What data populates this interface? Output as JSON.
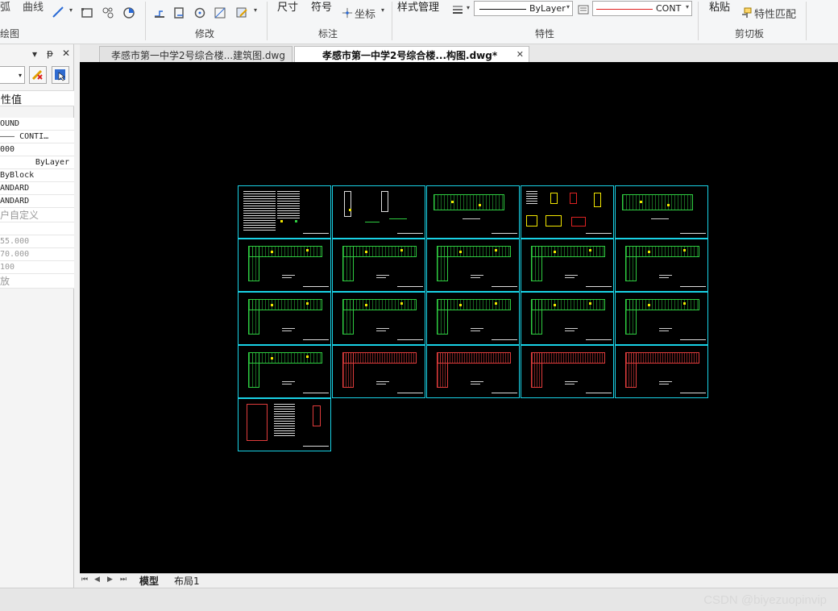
{
  "ribbon": {
    "draw_items": {
      "arc": "弧",
      "curve": "曲线"
    },
    "groups": {
      "draw": "绘图",
      "modify": "修改",
      "annotate": "标注",
      "properties": "特性",
      "clipboard": "剪切板"
    },
    "annotate_items": {
      "dimension": "尺寸",
      "symbol": "符号",
      "coordinate": "坐标"
    },
    "style_manager": "样式管理",
    "layer_dropdown": {
      "value": "ByLayer"
    },
    "linetype_dropdown": {
      "value": "CONT"
    },
    "clipboard_items": {
      "paste": "粘贴",
      "match_properties": "特性匹配"
    }
  },
  "palette": {
    "title_buttons": [
      "▾",
      "ᵽ",
      "✕"
    ],
    "header": "性值",
    "rows": [
      {
        "text": "OUND",
        "style": "normal"
      },
      {
        "text": "——— CONTI…",
        "style": "normal"
      },
      {
        "text": "000",
        "style": "normal"
      },
      {
        "text": "ByLayer",
        "style": "right"
      },
      {
        "text": "ByBlock",
        "style": "normal"
      },
      {
        "text": "ANDARD",
        "style": "normal"
      },
      {
        "text": "ANDARD",
        "style": "normal"
      },
      {
        "text": "户自定义",
        "style": "cat"
      },
      {
        "text": "",
        "style": "normal"
      },
      {
        "text": "55.000",
        "style": "gray"
      },
      {
        "text": "70.000",
        "style": "gray"
      },
      {
        "text": "100",
        "style": "gray"
      },
      {
        "text": "放",
        "style": "cat"
      }
    ]
  },
  "doc_tabs": [
    {
      "label": "孝感市第一中学2号综合楼...建筑图.dwg",
      "active": false
    },
    {
      "label": "孝感市第一中学2号综合楼...构图.dwg*",
      "active": true
    }
  ],
  "layout_tabs": [
    {
      "label": "模型",
      "active": true
    },
    {
      "label": "布局1",
      "active": false
    }
  ],
  "nav_buttons": [
    "⏮",
    "◀",
    "▶",
    "⏭"
  ],
  "watermark": "CSDN @biyezuopinvip",
  "colors": {
    "sheet_border": "#19d2e6",
    "plan_green": "#2ecc40",
    "plan_red": "#e03c3c",
    "canvas": "#000000"
  }
}
